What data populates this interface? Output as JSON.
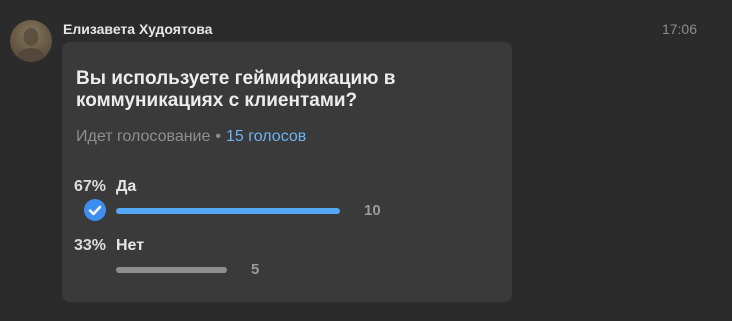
{
  "message": {
    "author": "Елизавета Худоятова",
    "time": "17:06"
  },
  "poll": {
    "question": "Вы используете геймификацию в коммуникациях с клиентами?",
    "status": "Идет голосование",
    "separator": "•",
    "votes_label": "15 голосов",
    "options": [
      {
        "percent": "67%",
        "label": "Да",
        "count": "10",
        "share": 0.67,
        "selected": true,
        "bar_color": "#55a8f5"
      },
      {
        "percent": "33%",
        "label": "Нет",
        "count": "5",
        "share": 0.33,
        "selected": false,
        "bar_color": "#8e8e8e"
      }
    ]
  }
}
